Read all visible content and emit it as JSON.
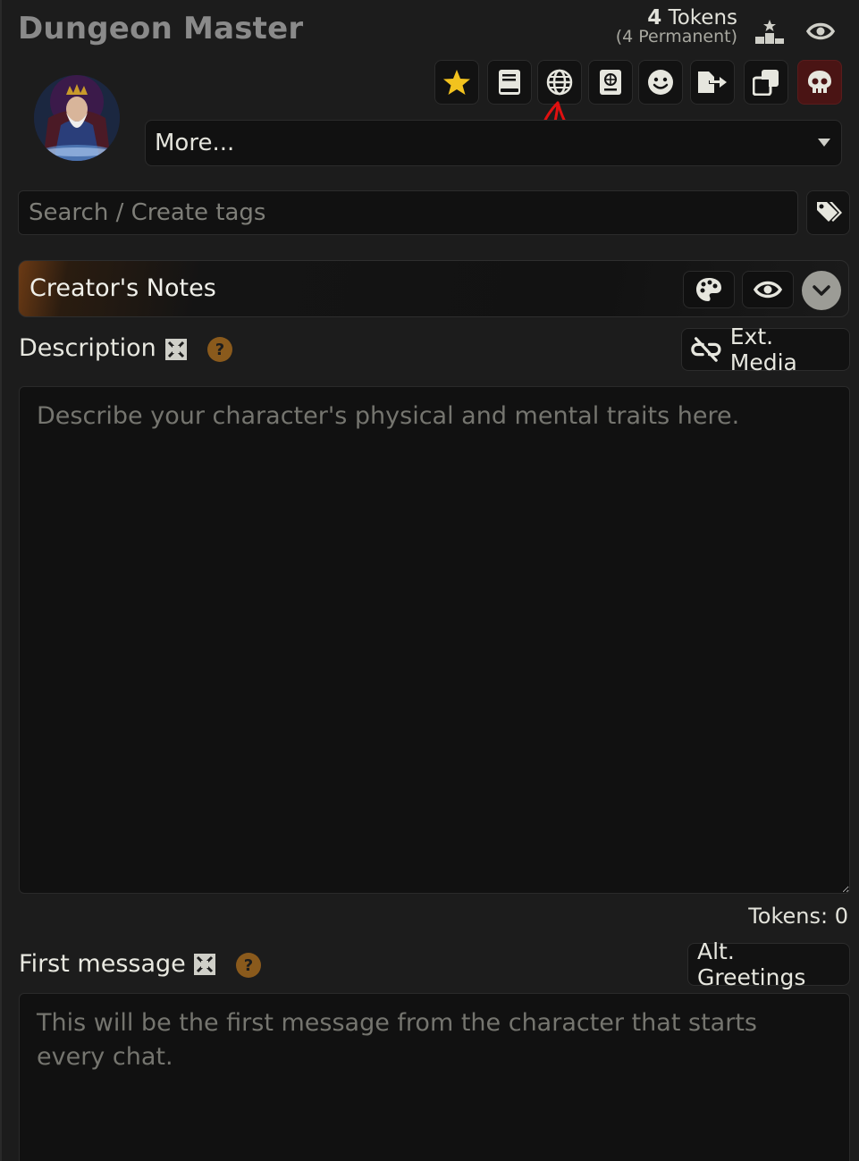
{
  "header": {
    "character_name": "Dungeon Master",
    "tokens_count": "4",
    "tokens_word": " Tokens",
    "tokens_permanent": "(4 Permanent)"
  },
  "icons": {
    "stats": "podium-icon",
    "visibility": "eye-icon",
    "favorite": "star-icon",
    "lorebook": "book-icon",
    "world_info": "globe-icon",
    "chat_lore": "passport-icon",
    "emotions": "smiley-icon",
    "export": "export-icon",
    "duplicate": "copy-icon",
    "delete": "skull-icon",
    "tags": "tags-icon",
    "palette": "palette-icon",
    "expand": "expand-icon",
    "help": "question-icon",
    "link": "unlink-icon",
    "chevron": "chevron-down-icon"
  },
  "more_select": {
    "value": "More..."
  },
  "tags": {
    "placeholder": "Search / Create tags"
  },
  "creators_notes": {
    "title": "Creator's Notes"
  },
  "description": {
    "label": "Description",
    "help": "?",
    "ext_media_label": "Ext. Media",
    "placeholder": "Describe your character's physical and mental traits here.",
    "tokens_label": "Tokens: 0"
  },
  "first_message": {
    "label": "First message",
    "help": "?",
    "alt_greetings_label": "Alt. Greetings",
    "placeholder": "This will be the first message from the character that starts every chat."
  },
  "colors": {
    "accent_red": "#e01010",
    "star": "#f2c21e",
    "help_bg": "#8a5a1c",
    "danger_bg": "#4a1414"
  }
}
